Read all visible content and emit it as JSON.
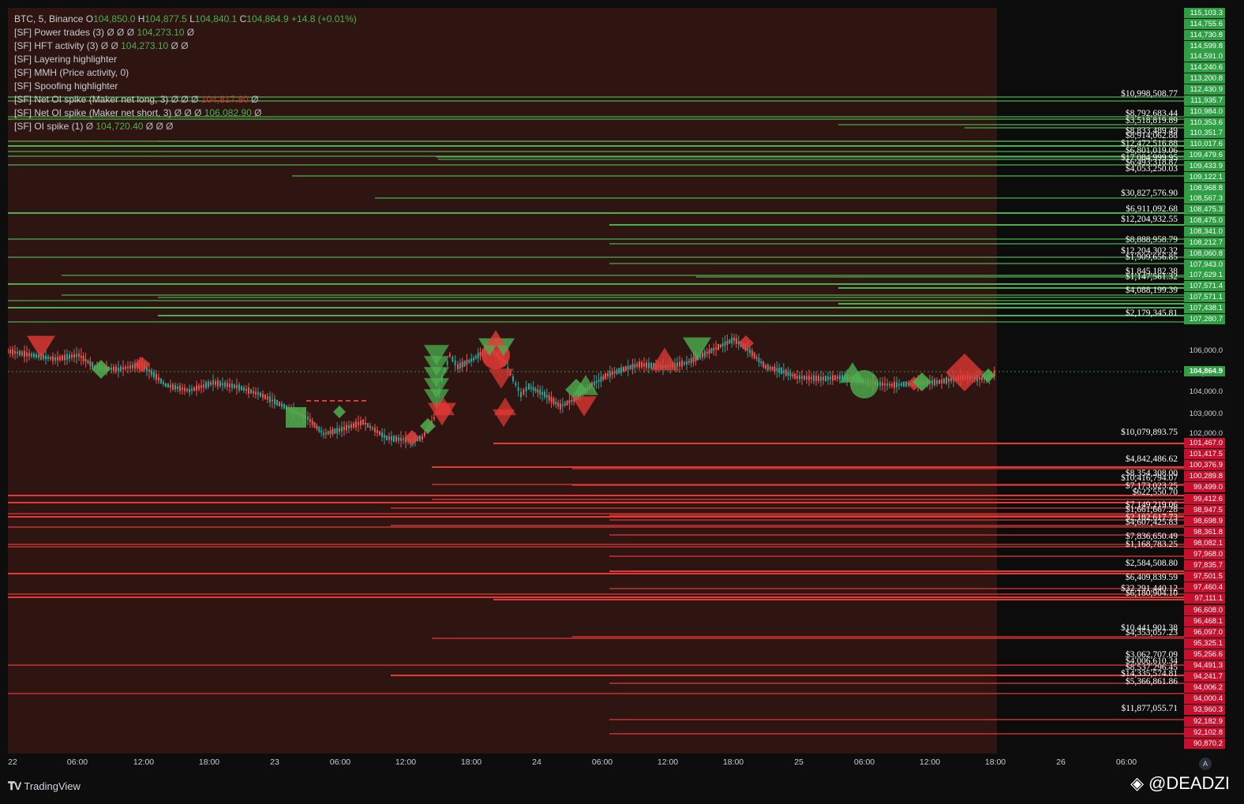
{
  "legend": {
    "main": {
      "symbol": "BTC, 5, Binance",
      "o_label": "O",
      "o": "104,850.0",
      "h_label": "H",
      "h": "104,877.5",
      "l_label": "L",
      "l": "104,840.1",
      "c_label": "C",
      "c": "104,864.9",
      "change": "+14.8 (+0.01%)"
    },
    "indicators": [
      {
        "label": "[SF] Power trades (3)",
        "values": [
          {
            "text": "Ø",
            "color": "n"
          },
          {
            "text": "Ø",
            "color": "n"
          },
          {
            "text": "Ø",
            "color": "n"
          },
          {
            "text": "104,273.10",
            "color": "g"
          },
          {
            "text": "Ø",
            "color": "n"
          }
        ]
      },
      {
        "label": "[SF] HFT activity (3)",
        "values": [
          {
            "text": "Ø",
            "color": "n"
          },
          {
            "text": "Ø",
            "color": "n"
          },
          {
            "text": "104,273.10",
            "color": "g"
          },
          {
            "text": "Ø",
            "color": "n"
          },
          {
            "text": "Ø",
            "color": "n"
          }
        ]
      },
      {
        "label": "[SF] Layering highlighter",
        "values": []
      },
      {
        "label": "[SF] MMH (Price activity, 0)",
        "values": []
      },
      {
        "label": "[SF] Spoofing highlighter",
        "values": []
      },
      {
        "label": "[SF] Net OI spike (Maker net long, 3)",
        "values": [
          {
            "text": "Ø",
            "color": "n"
          },
          {
            "text": "Ø",
            "color": "n"
          },
          {
            "text": "Ø",
            "color": "n"
          },
          {
            "text": "104,817.80",
            "color": "r"
          },
          {
            "text": "Ø",
            "color": "n"
          }
        ]
      },
      {
        "label": "[SF] Net OI spike (Maker net short, 3)",
        "values": [
          {
            "text": "Ø",
            "color": "n"
          },
          {
            "text": "Ø",
            "color": "n"
          },
          {
            "text": "Ø",
            "color": "n"
          },
          {
            "text": "106,082.90",
            "color": "g"
          },
          {
            "text": "Ø",
            "color": "n"
          }
        ]
      },
      {
        "label": "[SF] OI spike (1)",
        "values": [
          {
            "text": "Ø",
            "color": "n"
          },
          {
            "text": "104,720.40",
            "color": "g"
          },
          {
            "text": "Ø",
            "color": "n"
          },
          {
            "text": "Ø",
            "color": "n"
          },
          {
            "text": "Ø",
            "color": "n"
          }
        ]
      }
    ]
  },
  "price_axis": {
    "resistance_tags": [
      "115,103.3",
      "114,755.6",
      "114,730.8",
      "114,599.8",
      "114,591.0",
      "114,240.6",
      "113,200.8",
      "112,430.9",
      "111,935.7",
      "110,984.0",
      "110,353.6",
      "110,351.7",
      "110,017.6",
      "109,479.6",
      "109,433.9",
      "109,122.1",
      "108,968.8",
      "108,567.3",
      "108,475.3",
      "108,475.0",
      "108,341.0",
      "108,212.7",
      "108,060.8",
      "107,943.0",
      "107,629.1",
      "107,571.4",
      "107,571.1",
      "107,438.1",
      "107,280.7"
    ],
    "plain_ticks": [
      "106,000.0",
      "105,000.0",
      "104,000.0",
      "103,000.0",
      "102,000.0"
    ],
    "last_price": "104,864.9",
    "support_tags": [
      "101,467.0",
      "101,417.5",
      "100,376.9",
      "100,289.8",
      "99,499.0",
      "99,412.6",
      "98,947.5",
      "98,698.9",
      "98,361.8",
      "98,082.1",
      "97,968.0",
      "97,835.7",
      "97,501.5",
      "97,460.4",
      "97,111.1",
      "96,608.0",
      "96,468.1",
      "96,097.0",
      "95,325.1",
      "95,256.6",
      "94,491.3",
      "94,241.7",
      "94,006.2",
      "94,000.4",
      "93,960.3",
      "92,182.9",
      "92,102.8",
      "90,870.2"
    ]
  },
  "volume_labels": {
    "upper": [
      "$10,998,508.77",
      "$8,792,683.44",
      "$3,518,819.89",
      "$8,833,489.49",
      "$8,914,062.88",
      "$12,472,516.88",
      "$6,801,019.06",
      "$17,084,999.95",
      "$6,493,318.87",
      "$4,053,250.03",
      "$30,827,576.90",
      "$6,911,092.68",
      "$12,204,932.55",
      "$8,888,958.79",
      "$12,204,302.32",
      "$1,909,656.85",
      "$1,845,182.38",
      "$1,147,561.32",
      "$4,088,199.39",
      "$2,179,345.81"
    ],
    "lower": [
      "$10,079,893.75",
      "$4,842,486.62",
      "$8,354,308.00",
      "$10,416,794.07",
      "$7,173,023.25",
      "$622,550.70",
      "$7,149,219.06",
      "$1,661,667.28",
      "$2,182,617.73",
      "$4,607,425.83",
      "$7,836,650.49",
      "$1,168,783.25",
      "$2,584,508.80",
      "$6,409,839.59",
      "$32,291,440.12",
      "$6,180,904.10",
      "$10,441,901.38",
      "$4,353,057.23",
      "$3,062,707.09",
      "$4,006,610.34",
      "$8,537,296.45",
      "$14,335,574.81",
      "$5,366,861.86",
      "$11,877,055.71"
    ]
  },
  "time_axis": [
    "22",
    "06:00",
    "12:00",
    "18:00",
    "23",
    "06:00",
    "12:00",
    "18:00",
    "24",
    "06:00",
    "12:00",
    "18:00",
    "25",
    "06:00",
    "12:00",
    "18:00",
    "26",
    "06:00"
  ],
  "branding": {
    "tv": "TradingView",
    "watermark": "@DEADZI",
    "auto": "A"
  },
  "colors": {
    "green": "#4caf50",
    "red": "#e53935",
    "zone": "#2e1512",
    "bg": "#0c0c0c"
  }
}
